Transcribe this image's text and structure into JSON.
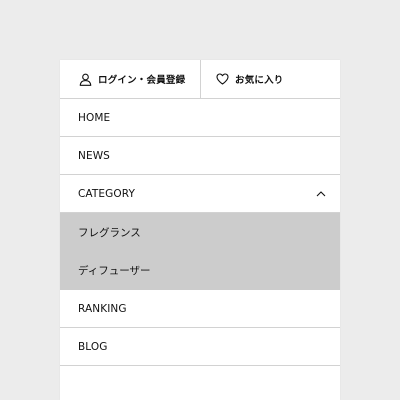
{
  "top_bar": {
    "login_label": "ログイン・会員登録",
    "favorites_label": "お気に入り"
  },
  "menu": {
    "home": "HOME",
    "news": "NEWS",
    "category": {
      "label": "CATEGORY",
      "expanded": true,
      "items": [
        "フレグランス",
        "ディフューザー"
      ]
    },
    "ranking": "RANKING",
    "blog": "BLOG"
  },
  "icons": {
    "login": "user-icon",
    "favorites": "heart-icon",
    "category_toggle": "chevron-up-icon"
  },
  "colors": {
    "page_background": "#ececec",
    "panel_background": "#ffffff",
    "submenu_background": "#cccccc",
    "divider": "#d2d2d2",
    "text": "#111111"
  }
}
